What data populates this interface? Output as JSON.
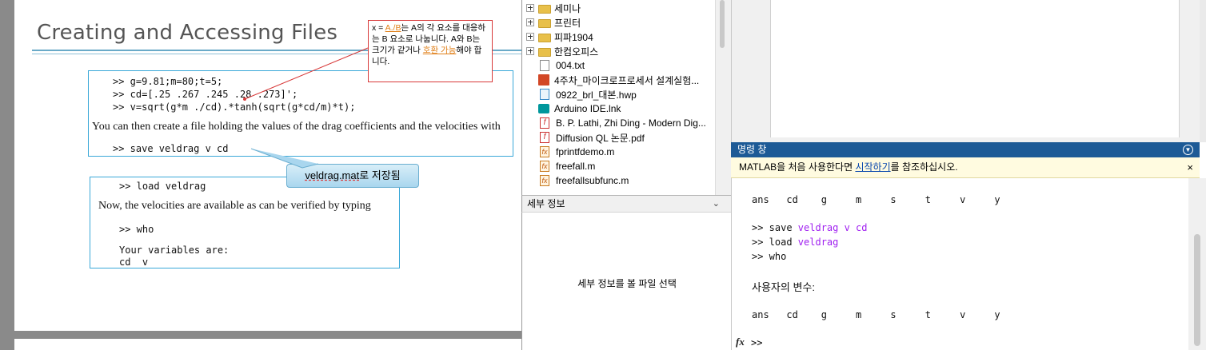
{
  "slide": {
    "title": "Creating and Accessing Files",
    "box1": {
      "code_lines": [
        ">> g=9.81;m=80;t=5;",
        ">> cd=[.25 .267 .245 .28 .273]';",
        ">> v=sqrt(g*m ./cd).*tanh(sqrt(g*cd/m)*t);"
      ],
      "prose": "You can then create a file holding the values of the drag coefficients and the velocities with",
      "save_cmd": ">> save veldrag v cd"
    },
    "box2": {
      "load_cmd": ">> load veldrag",
      "prose": "Now, the velocities are available as can be verified by typing",
      "who_cmd": ">> who",
      "vars_header": "Your variables are:",
      "vars_list": "cd  v"
    },
    "note": {
      "prefix": "x = ",
      "link1": "A./B",
      "mid1": "는 A의 각 요소를 대응하는 B 요소로 나눕니다. A와 B는 크기가 같거나 ",
      "link2": "호환 가능",
      "suffix": "해야 합니다."
    },
    "bubble": {
      "underlined": "veldrag.mat",
      "rest": "로 저장됨"
    }
  },
  "file_browser": {
    "items": [
      {
        "label": "세미나",
        "type": "folder"
      },
      {
        "label": "프린터",
        "type": "folder"
      },
      {
        "label": "피파1904",
        "type": "folder"
      },
      {
        "label": "한컴오피스",
        "type": "folder"
      },
      {
        "label": "004.txt",
        "type": "txt"
      },
      {
        "label": "4주차_마이크로프로세서 설계실험...",
        "type": "ppt"
      },
      {
        "label": "0922_brl_대본.hwp",
        "type": "hwp"
      },
      {
        "label": "Arduino IDE.lnk",
        "type": "lnk"
      },
      {
        "label": "B. P. Lathi, Zhi Ding - Modern Dig...",
        "type": "pdf"
      },
      {
        "label": "Diffusion QL 논문.pdf",
        "type": "pdf"
      },
      {
        "label": "fprintfdemo.m",
        "type": "m"
      },
      {
        "label": "freefall.m",
        "type": "m"
      },
      {
        "label": "freefallsubfunc.m",
        "type": "m"
      }
    ]
  },
  "details": {
    "header": "세부 정보",
    "message": "세부 정보를 볼 파일 선택"
  },
  "command_window": {
    "title": "명령 창",
    "notice_prefix": "MATLAB을 처음 사용한다면 ",
    "notice_link": "시작하기",
    "notice_suffix": "를 참조하십시오.",
    "close": "×",
    "vars_row_1": "ans   cd    g     m     s     t     v     y",
    "save_prefix": ">> save ",
    "save_args": "veldrag v cd",
    "load_prefix": ">> load ",
    "load_args": "veldrag",
    "who_line": ">> who",
    "vars_header": "사용자의 변수:",
    "vars_row_2": "ans   cd    g     m     s     t     v     y",
    "fx_label": "fx",
    "prompt": ">>"
  },
  "colors": {
    "cmd_header_bg": "#1d5a96",
    "variable_purple": "#a020f0",
    "link_blue": "#0645ad",
    "note_border": "#d83a3a"
  }
}
